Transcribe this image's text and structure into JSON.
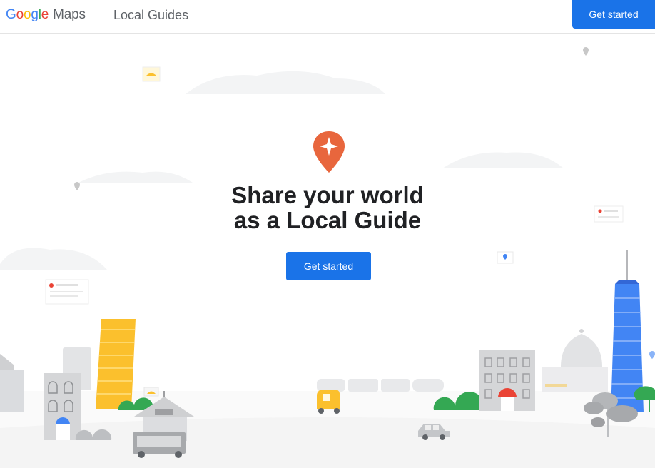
{
  "header": {
    "logo_letters": [
      "G",
      "o",
      "o",
      "g",
      "l",
      "e"
    ],
    "logo_product": "Maps",
    "nav_title": "Local Guides",
    "cta_label": "Get started"
  },
  "hero": {
    "icon": "local-guide-pin-icon",
    "headline_line1": "Share your world",
    "headline_line2": "as a Local Guide",
    "cta_label": "Get started"
  },
  "colors": {
    "primary_blue": "#1a73e8",
    "pin_orange": "#e8663d",
    "building_yellow": "#fbc02d",
    "tower_blue": "#3367d6"
  }
}
